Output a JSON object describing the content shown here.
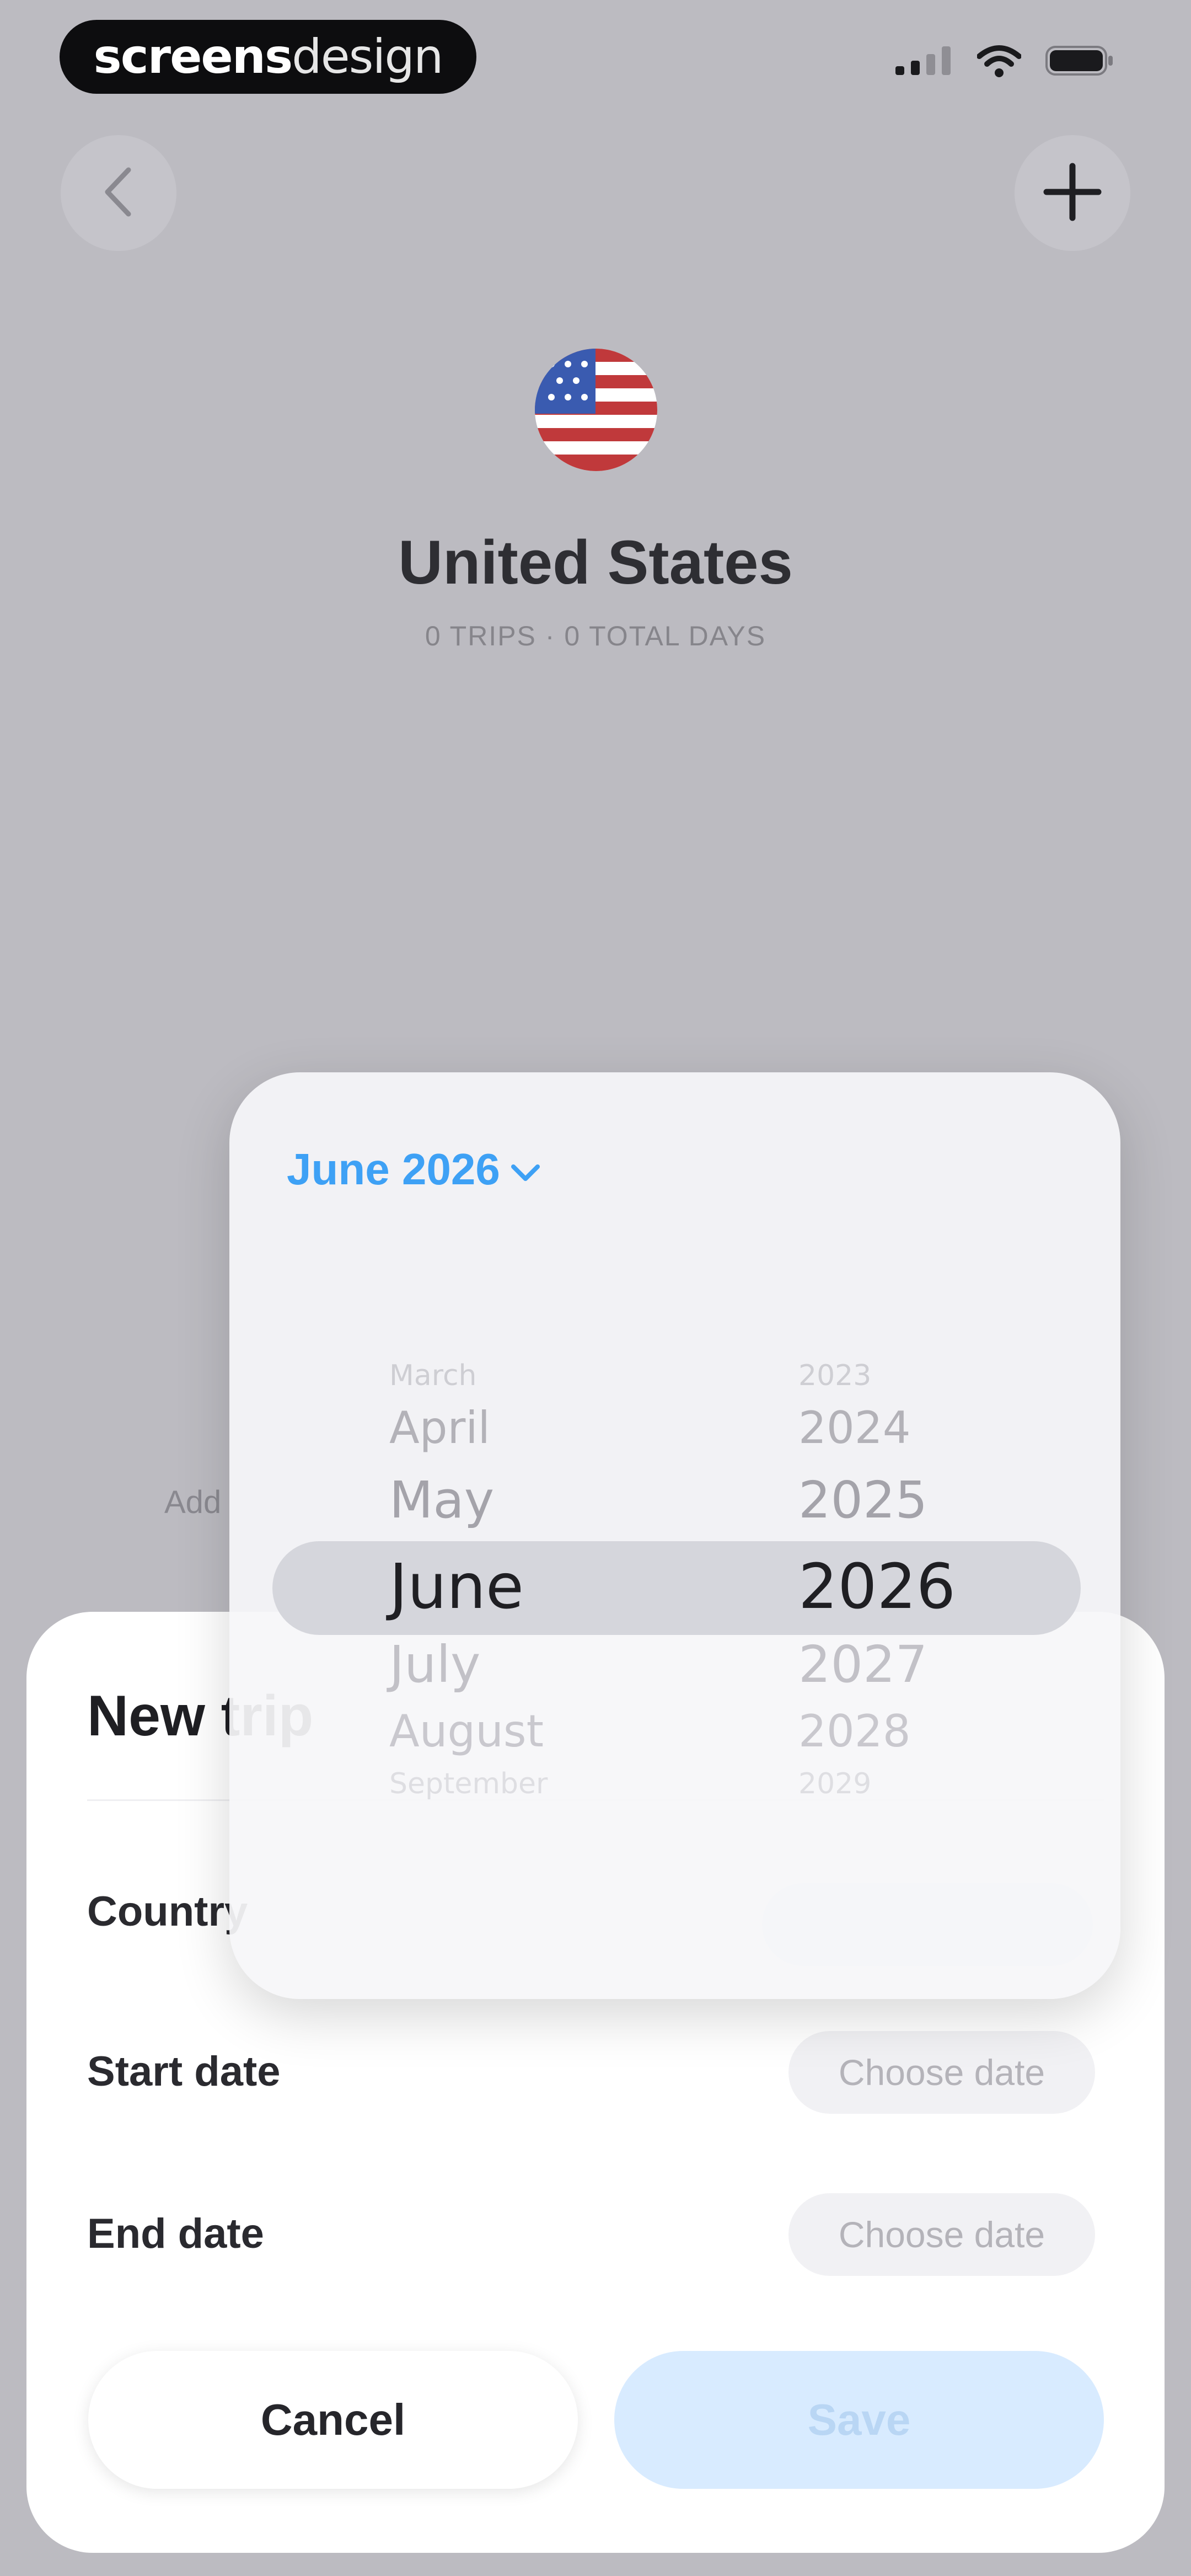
{
  "status_bar": {
    "brand_part1": "screens",
    "brand_part2": "design"
  },
  "nav": {
    "back_icon": "chevron-left-icon",
    "add_icon": "plus-icon"
  },
  "country": {
    "flag_icon": "us-flag-icon",
    "name": "United States",
    "stats": "0 TRIPS · 0 TOTAL DAYS",
    "add_hint": "Add"
  },
  "sheet": {
    "title": "New trip",
    "country_label": "Country",
    "start_label": "Start date",
    "start_value": "Choose date",
    "end_label": "End date",
    "end_value": "Choose date",
    "cancel_label": "Cancel",
    "save_label": "Save"
  },
  "picker": {
    "header": "June 2026",
    "months": [
      "March",
      "April",
      "May",
      "June",
      "July",
      "August",
      "September"
    ],
    "years": [
      "2023",
      "2024",
      "2025",
      "2026",
      "2027",
      "2028",
      "2029"
    ],
    "selected_month": "June",
    "selected_year": "2026",
    "accent": "#3ea1f5"
  }
}
